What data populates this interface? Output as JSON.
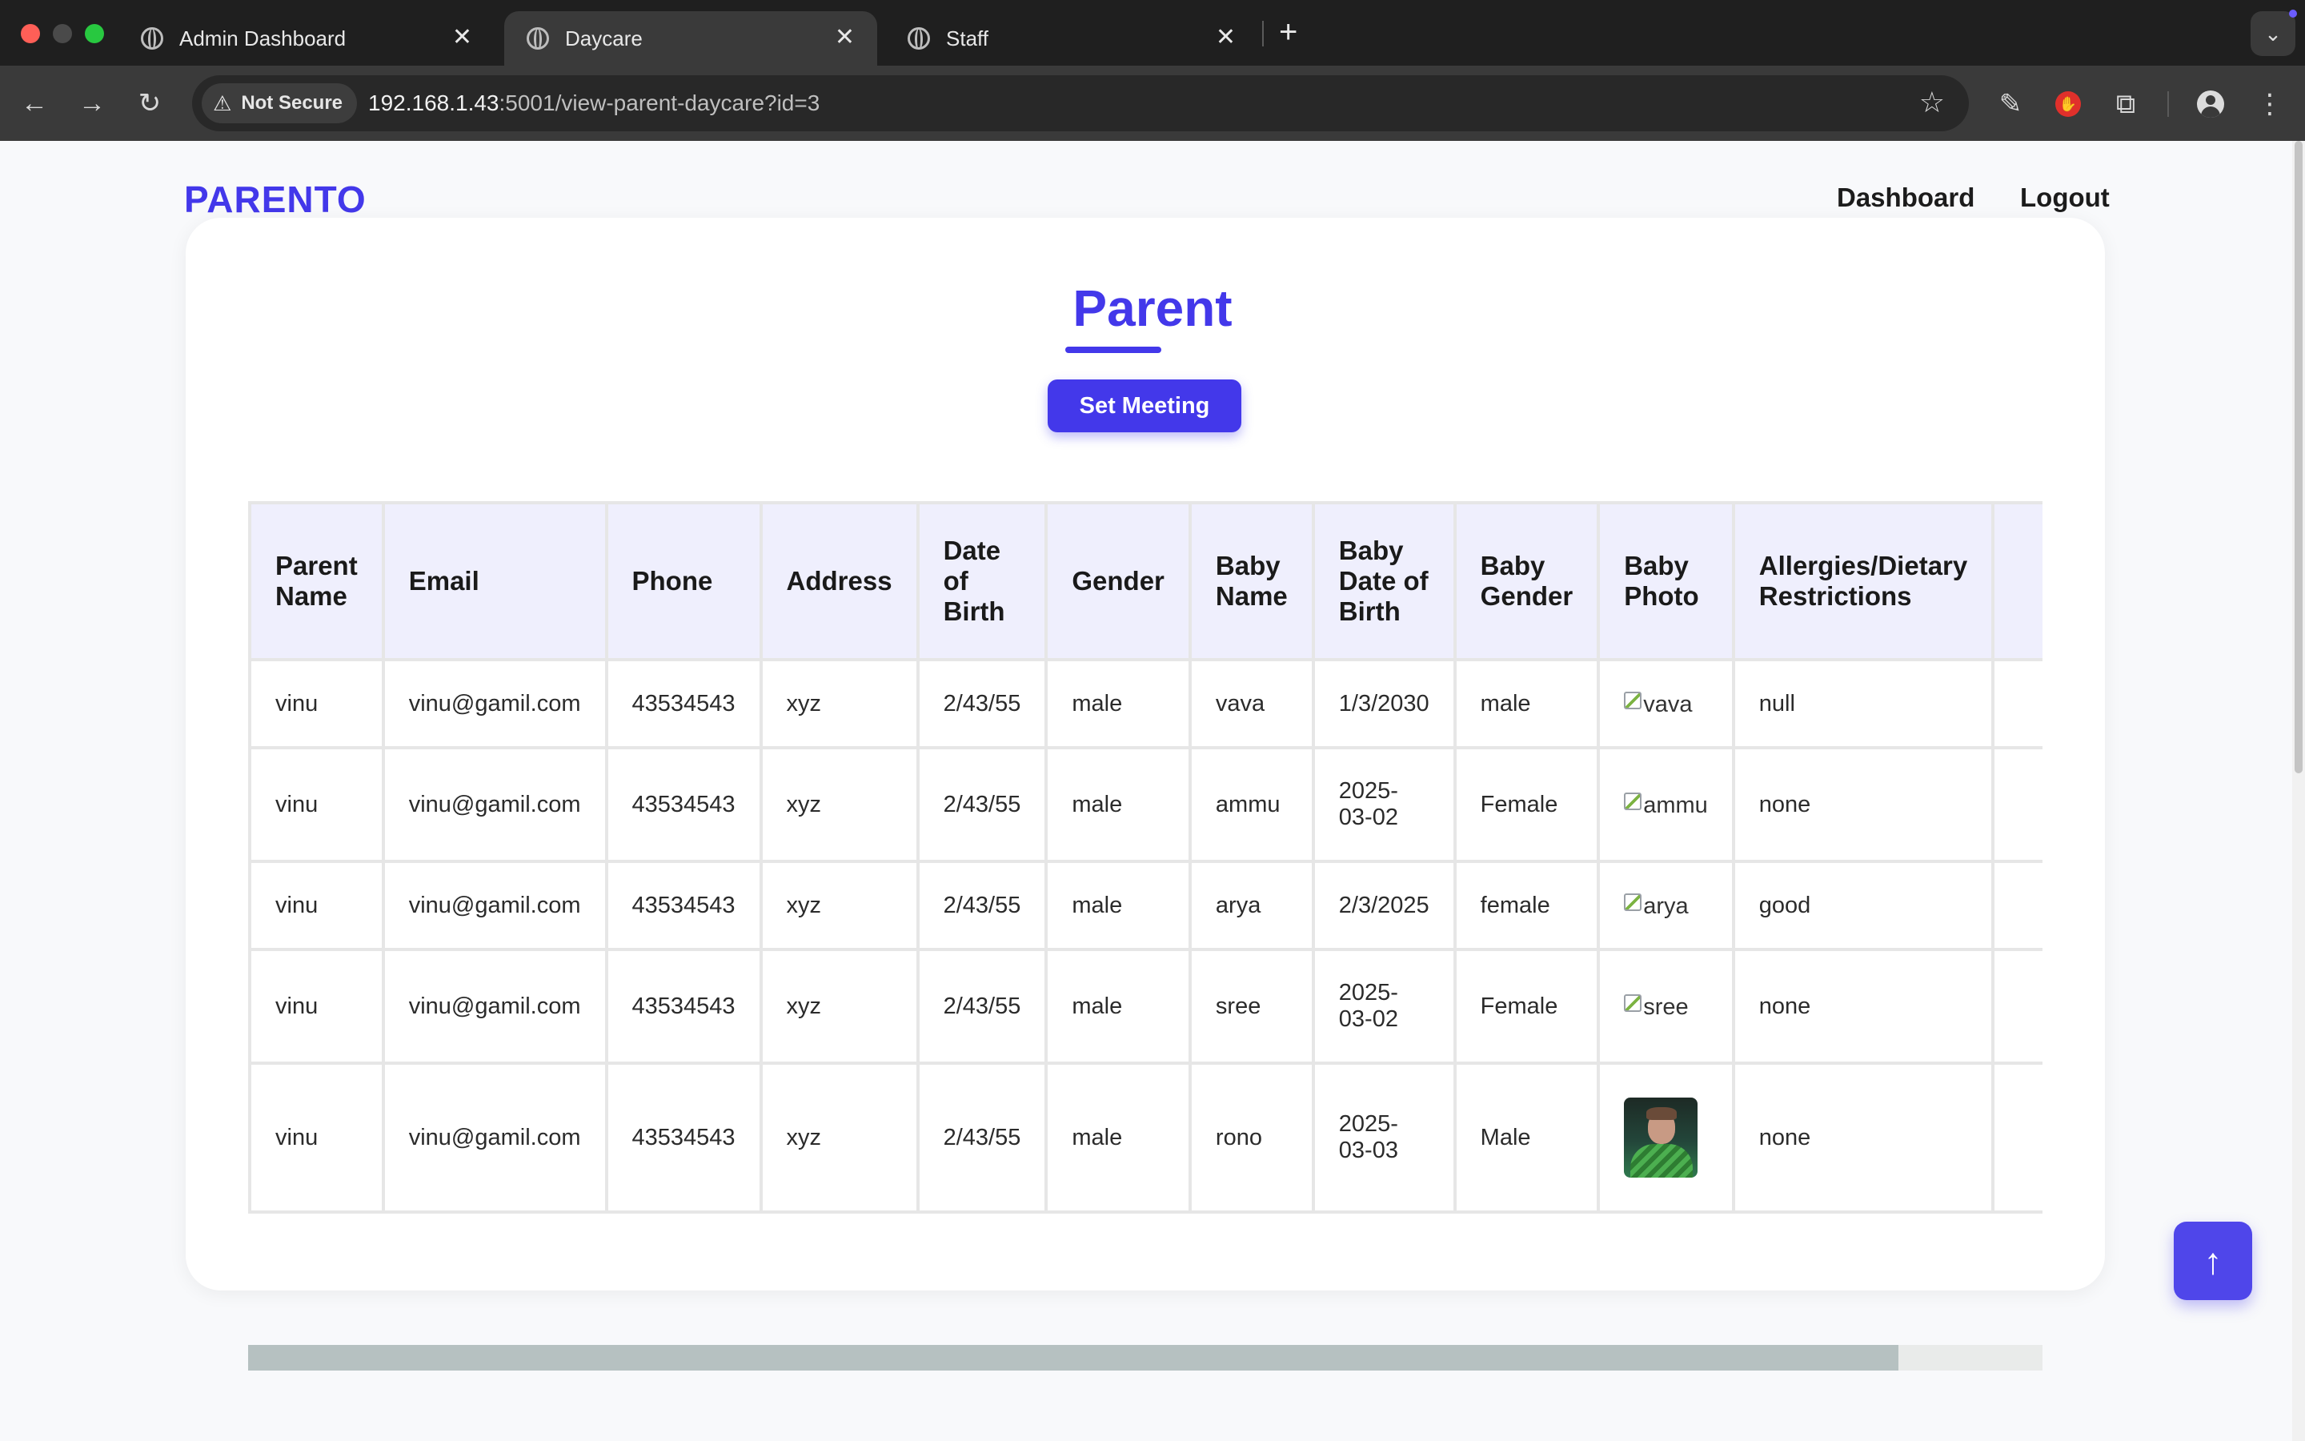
{
  "browser": {
    "tabs": [
      {
        "title": "Admin Dashboard",
        "active": false
      },
      {
        "title": "Daycare",
        "active": true
      },
      {
        "title": "Staff",
        "active": false
      }
    ],
    "security_label": "Not Secure",
    "url_host": "192.168.1.43",
    "url_rest": ":5001/view-parent-daycare?id=3"
  },
  "site": {
    "brand": "PARENTO",
    "nav": [
      {
        "label": "Dashboard"
      },
      {
        "label": "Logout"
      }
    ]
  },
  "card": {
    "title": "Parent",
    "button_label": "Set Meeting"
  },
  "table": {
    "headers": [
      "Parent Name",
      "Email",
      "Phone",
      "Address",
      "Date of Birth",
      "Gender",
      "Baby Name",
      "Baby Date of Birth",
      "Baby Gender",
      "Baby Photo",
      "Allergies/Dietary Restrictions"
    ],
    "rows": [
      {
        "parent_name": "vinu",
        "email": "vinu@gamil.com",
        "phone": "43534543",
        "address": "xyz",
        "dob": "2/43/55",
        "gender": "male",
        "baby_name": "vava",
        "baby_dob": "1/3/2030",
        "baby_gender": "male",
        "photo": {
          "type": "broken",
          "alt": "vava"
        },
        "allergies": "null"
      },
      {
        "parent_name": "vinu",
        "email": "vinu@gamil.com",
        "phone": "43534543",
        "address": "xyz",
        "dob": "2/43/55",
        "gender": "male",
        "baby_name": "ammu",
        "baby_dob": "2025-03-02",
        "baby_gender": "Female",
        "photo": {
          "type": "broken",
          "alt": "ammu"
        },
        "allergies": "none"
      },
      {
        "parent_name": "vinu",
        "email": "vinu@gamil.com",
        "phone": "43534543",
        "address": "xyz",
        "dob": "2/43/55",
        "gender": "male",
        "baby_name": "arya",
        "baby_dob": "2/3/2025",
        "baby_gender": "female",
        "photo": {
          "type": "broken",
          "alt": "arya"
        },
        "allergies": "good"
      },
      {
        "parent_name": "vinu",
        "email": "vinu@gamil.com",
        "phone": "43534543",
        "address": "xyz",
        "dob": "2/43/55",
        "gender": "male",
        "baby_name": "sree",
        "baby_dob": "2025-03-02",
        "baby_gender": "Female",
        "photo": {
          "type": "broken",
          "alt": "sree"
        },
        "allergies": "none"
      },
      {
        "parent_name": "vinu",
        "email": "vinu@gamil.com",
        "phone": "43534543",
        "address": "xyz",
        "dob": "2/43/55",
        "gender": "male",
        "baby_name": "rono",
        "baby_dob": "2025-03-03",
        "baby_gender": "Male",
        "photo": {
          "type": "image",
          "alt": "rono"
        },
        "allergies": "none"
      }
    ]
  },
  "colors": {
    "accent": "#4338ea",
    "header_bg": "#efeffd"
  },
  "icons": {
    "back": "arrow-left-icon",
    "forward": "arrow-right-icon",
    "reload": "reload-icon",
    "bookmark": "star-icon",
    "scroll_top": "arrow-up-icon"
  }
}
